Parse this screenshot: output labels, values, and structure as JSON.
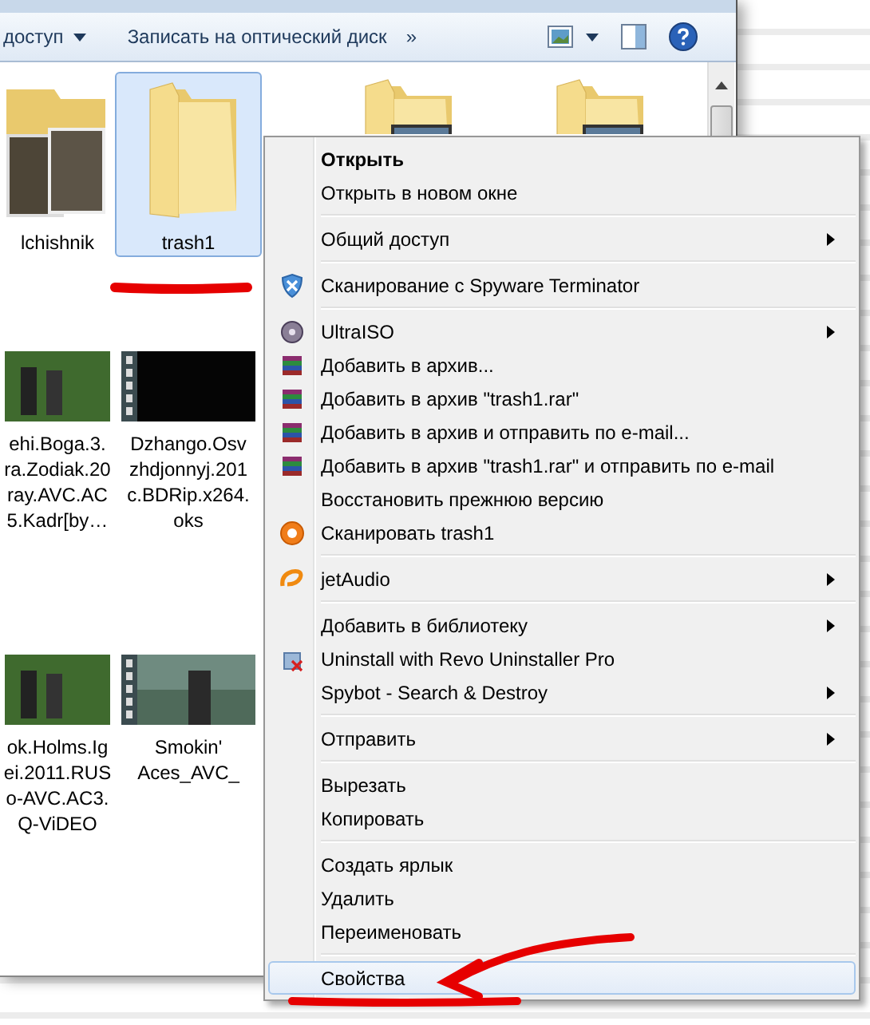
{
  "toolbar": {
    "items": [
      {
        "kind": "dropdown",
        "label": "доступ"
      },
      {
        "kind": "button",
        "label": "Записать на оптический диск"
      },
      {
        "kind": "overflow",
        "label": "»"
      }
    ]
  },
  "file_rows": [
    {
      "items": [
        {
          "kind": "video-stack",
          "label": "lchishnik",
          "selected": false
        },
        {
          "kind": "folder",
          "label": "trash1",
          "selected": true
        },
        {
          "kind": "hidden-folder",
          "selected": false
        },
        {
          "kind": "hidden-folder",
          "selected": false
        }
      ]
    },
    {
      "items": [
        {
          "kind": "video",
          "label": "ehi.Boga.3.\nra.Zodiak.20\nray.AVC.AC\n5.Kadr[by…",
          "selected": false
        },
        {
          "kind": "video-dark",
          "label": "Dzhango.Osv\nzhdjonnyj.201\nc.BDRip.x264.\noks",
          "selected": false
        }
      ]
    },
    {
      "items": [
        {
          "kind": "video",
          "label": "ok.Holms.Ig\nei.2011.RUS\no-AVC.AC3.\nQ-ViDEO",
          "selected": false
        },
        {
          "kind": "video-scene",
          "label": "Smokin'\nAces_AVC_",
          "selected": false
        }
      ]
    }
  ],
  "context_menu": {
    "items": [
      {
        "kind": "item",
        "label": "Открыть",
        "bold": true,
        "submenu": false,
        "selected": false
      },
      {
        "kind": "item",
        "label": "Открыть в новом окне",
        "bold": false,
        "submenu": false,
        "selected": false
      },
      {
        "kind": "separator"
      },
      {
        "kind": "item",
        "label": "Общий доступ",
        "bold": false,
        "submenu": true,
        "selected": false
      },
      {
        "kind": "separator"
      },
      {
        "kind": "scanner",
        "label": "Сканирование с Spyware Terminator",
        "bold": false,
        "submenu": false,
        "selected": false
      },
      {
        "kind": "separator"
      },
      {
        "kind": "disc",
        "label": "UltraISO",
        "bold": false,
        "submenu": true,
        "selected": false
      },
      {
        "kind": "archive",
        "label": "Добавить в архив...",
        "bold": false,
        "submenu": false,
        "selected": false
      },
      {
        "kind": "archive",
        "label": "Добавить в архив \"trash1.rar\"",
        "bold": false,
        "submenu": false,
        "selected": false
      },
      {
        "kind": "archive",
        "label": "Добавить в архив и отправить по e-mail...",
        "bold": false,
        "submenu": false,
        "selected": false
      },
      {
        "kind": "archive",
        "label": "Добавить в архив \"trash1.rar\" и отправить по e-mail",
        "bold": false,
        "submenu": false,
        "selected": false
      },
      {
        "kind": "item",
        "label": "Восстановить прежнюю версию",
        "bold": false,
        "submenu": false,
        "selected": false
      },
      {
        "kind": "antivirus",
        "label": "Сканировать trash1",
        "bold": false,
        "submenu": false,
        "selected": false
      },
      {
        "kind": "separator"
      },
      {
        "kind": "player",
        "label": "jetAudio",
        "bold": false,
        "submenu": true,
        "selected": false
      },
      {
        "kind": "separator"
      },
      {
        "kind": "item",
        "label": "Добавить в библиотеку",
        "bold": false,
        "submenu": true,
        "selected": false
      },
      {
        "kind": "uninstaller",
        "label": "Uninstall with Revo Uninstaller Pro",
        "bold": false,
        "submenu": false,
        "selected": false
      },
      {
        "kind": "item",
        "label": "Spybot - Search & Destroy",
        "bold": false,
        "submenu": true,
        "selected": false
      },
      {
        "kind": "separator"
      },
      {
        "kind": "item",
        "label": "Отправить",
        "bold": false,
        "submenu": true,
        "selected": false
      },
      {
        "kind": "separator"
      },
      {
        "kind": "item",
        "label": "Вырезать",
        "bold": false,
        "submenu": false,
        "selected": false
      },
      {
        "kind": "item",
        "label": "Копировать",
        "bold": false,
        "submenu": false,
        "selected": false
      },
      {
        "kind": "separator"
      },
      {
        "kind": "item",
        "label": "Создать ярлык",
        "bold": false,
        "submenu": false,
        "selected": false
      },
      {
        "kind": "item",
        "label": "Удалить",
        "bold": false,
        "submenu": false,
        "selected": false
      },
      {
        "kind": "item",
        "label": "Переименовать",
        "bold": false,
        "submenu": false,
        "selected": false
      },
      {
        "kind": "separator"
      },
      {
        "kind": "item",
        "label": "Свойства",
        "bold": false,
        "submenu": false,
        "selected": true
      }
    ]
  }
}
